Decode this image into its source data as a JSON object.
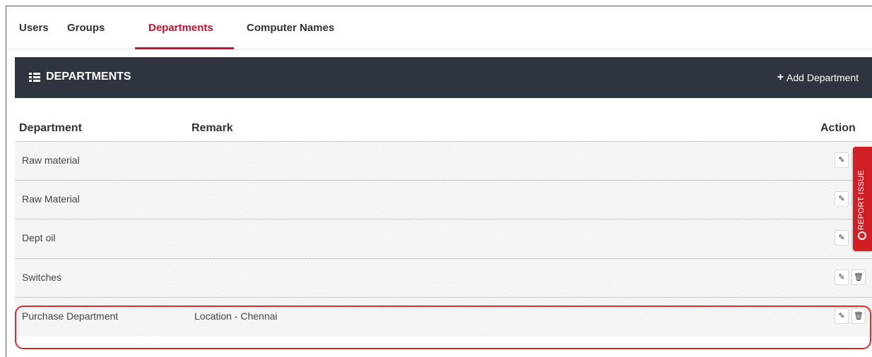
{
  "tabs": [
    {
      "label": "Users"
    },
    {
      "label": "Groups"
    },
    {
      "label": "Departments",
      "active": true
    },
    {
      "label": "Computer Names"
    }
  ],
  "panel": {
    "title": "DEPARTMENTS",
    "title_icon": "list-icon",
    "add_label": "Add Department",
    "add_icon": "plus-icon"
  },
  "columns": {
    "department": "Department",
    "remark": "Remark",
    "action": "Action"
  },
  "rows": [
    {
      "department": "Raw material",
      "remark": ""
    },
    {
      "department": "Raw Material",
      "remark": ""
    },
    {
      "department": "Dept oil",
      "remark": ""
    },
    {
      "department": "Switches",
      "remark": ""
    },
    {
      "department": "Purchase Department",
      "remark": "Location - Chennai",
      "highlighted": true
    }
  ],
  "row_actions": {
    "edit_icon": "pencil-icon",
    "delete_icon": "trash-icon"
  },
  "report_issue": {
    "label": "REPORT ISSUE"
  },
  "colors": {
    "accent": "#c8102e",
    "header_bg": "#2f3540",
    "highlight": "#e32929",
    "report_tab": "#d21f26"
  }
}
